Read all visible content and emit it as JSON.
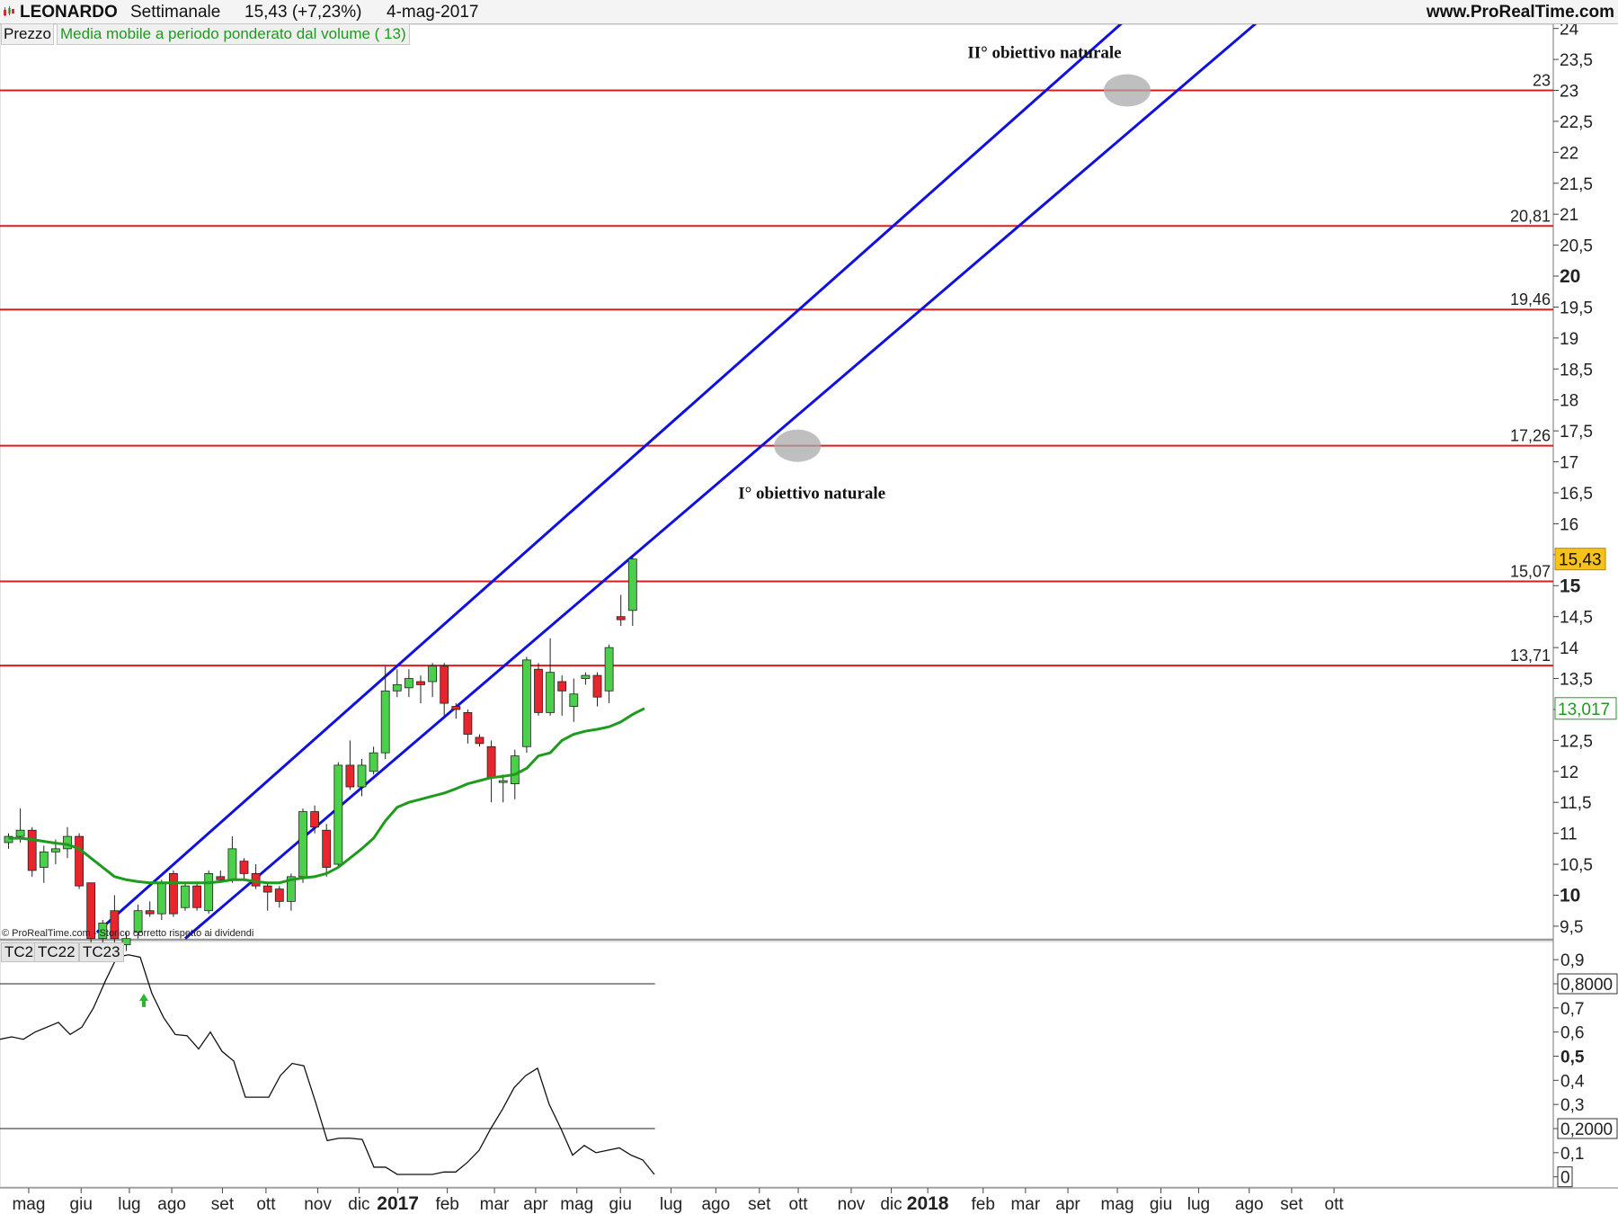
{
  "header": {
    "symbol": "LEONARDO",
    "timeframe": "Settimanale",
    "price_change": "15,43 (+7,23%)",
    "date": "4-mag-2017",
    "website": "www.ProRealTime.com"
  },
  "legend": {
    "price_label": "Prezzo",
    "indicator_label": "Media mobile a periodo ponderato dal volume ( 13)",
    "indicator_color": "#1f9a1f"
  },
  "oscillator_tabs": [
    "TC2",
    "TC22",
    "TC23"
  ],
  "copyright": "© ProRealTime.com - Storico corretto rispetto ai dividendi",
  "colors": {
    "up": "#4cd04c",
    "down": "#e8242c",
    "support_lines": "#e01b1b",
    "channel": "#1010e0",
    "moving_average": "#1f9a1f",
    "last_price_badge": "#f7c21c"
  },
  "chart_data": [
    {
      "type": "candlestick",
      "title": "LEONARDO Settimanale",
      "ylim": [
        9.3,
        24.2
      ],
      "y_ticks": [
        "24",
        "23,5",
        "23",
        "22,5",
        "22",
        "21,5",
        "21",
        "20,5",
        "20",
        "19,5",
        "19",
        "18,5",
        "18",
        "17,5",
        "17",
        "16,5",
        "16",
        "15,5",
        "15",
        "14,5",
        "14",
        "13,5",
        "13",
        "12,5",
        "12",
        "11,5",
        "11",
        "10,5",
        "10",
        "9,5"
      ],
      "y_tick_values": [
        24,
        23.5,
        23,
        22.5,
        22,
        21.5,
        21,
        20.5,
        20,
        19.5,
        19,
        18.5,
        18,
        17.5,
        17,
        16.5,
        16,
        15.5,
        15,
        14.5,
        14,
        13.5,
        13,
        12.5,
        12,
        11.5,
        11,
        10.5,
        10,
        9.5
      ],
      "x_labels": [
        "mag",
        "giu",
        "lug",
        "ago",
        "set",
        "ott",
        "nov",
        "dic",
        "2017",
        "feb",
        "mar",
        "apr",
        "mag",
        "giu",
        "lug",
        "ago",
        "set",
        "ott",
        "nov",
        "dic",
        "2018",
        "feb",
        "mar",
        "apr",
        "mag",
        "giu",
        "lug",
        "ago",
        "set",
        "ott"
      ],
      "candles": [
        {
          "o": 10.85,
          "h": 11.0,
          "l": 10.75,
          "c": 10.95
        },
        {
          "o": 10.95,
          "h": 11.4,
          "l": 10.85,
          "c": 11.05
        },
        {
          "o": 11.05,
          "h": 11.1,
          "l": 10.3,
          "c": 10.4
        },
        {
          "o": 10.45,
          "h": 10.8,
          "l": 10.2,
          "c": 10.7
        },
        {
          "o": 10.7,
          "h": 10.9,
          "l": 10.5,
          "c": 10.75
        },
        {
          "o": 10.75,
          "h": 11.1,
          "l": 10.6,
          "c": 10.95
        },
        {
          "o": 10.95,
          "h": 11.0,
          "l": 10.1,
          "c": 10.15
        },
        {
          "o": 10.2,
          "h": 10.2,
          "l": 9.2,
          "c": 9.3
        },
        {
          "o": 9.3,
          "h": 9.6,
          "l": 9.1,
          "c": 9.55
        },
        {
          "o": 9.75,
          "h": 10.0,
          "l": 9.2,
          "c": 9.3
        },
        {
          "o": 9.2,
          "h": 9.4,
          "l": 9.1,
          "c": 9.3
        },
        {
          "o": 9.4,
          "h": 9.85,
          "l": 9.3,
          "c": 9.75
        },
        {
          "o": 9.75,
          "h": 9.9,
          "l": 9.65,
          "c": 9.7
        },
        {
          "o": 9.7,
          "h": 10.25,
          "l": 9.6,
          "c": 10.2
        },
        {
          "o": 10.35,
          "h": 10.4,
          "l": 9.65,
          "c": 9.7
        },
        {
          "o": 9.8,
          "h": 10.2,
          "l": 9.75,
          "c": 10.15
        },
        {
          "o": 10.15,
          "h": 10.2,
          "l": 9.75,
          "c": 9.8
        },
        {
          "o": 9.75,
          "h": 10.4,
          "l": 9.7,
          "c": 10.35
        },
        {
          "o": 10.3,
          "h": 10.4,
          "l": 10.2,
          "c": 10.25
        },
        {
          "o": 10.25,
          "h": 10.95,
          "l": 10.2,
          "c": 10.75
        },
        {
          "o": 10.55,
          "h": 10.6,
          "l": 10.25,
          "c": 10.35
        },
        {
          "o": 10.35,
          "h": 10.5,
          "l": 10.1,
          "c": 10.15
        },
        {
          "o": 10.15,
          "h": 10.2,
          "l": 9.75,
          "c": 10.05
        },
        {
          "o": 10.1,
          "h": 10.15,
          "l": 9.8,
          "c": 9.9
        },
        {
          "o": 9.9,
          "h": 10.35,
          "l": 9.75,
          "c": 10.3
        },
        {
          "o": 10.3,
          "h": 11.4,
          "l": 10.2,
          "c": 11.35
        },
        {
          "o": 11.35,
          "h": 11.45,
          "l": 11.0,
          "c": 11.1
        },
        {
          "o": 11.05,
          "h": 11.15,
          "l": 10.3,
          "c": 10.45
        },
        {
          "o": 10.5,
          "h": 12.15,
          "l": 10.45,
          "c": 12.1
        },
        {
          "o": 12.1,
          "h": 12.5,
          "l": 11.7,
          "c": 11.75
        },
        {
          "o": 11.75,
          "h": 12.2,
          "l": 11.6,
          "c": 12.1
        },
        {
          "o": 12.0,
          "h": 12.4,
          "l": 11.95,
          "c": 12.3
        },
        {
          "o": 12.3,
          "h": 13.7,
          "l": 12.2,
          "c": 13.3
        },
        {
          "o": 13.3,
          "h": 13.65,
          "l": 13.2,
          "c": 13.4
        },
        {
          "o": 13.35,
          "h": 13.65,
          "l": 13.2,
          "c": 13.5
        },
        {
          "o": 13.45,
          "h": 13.55,
          "l": 13.1,
          "c": 13.4
        },
        {
          "o": 13.45,
          "h": 13.75,
          "l": 13.2,
          "c": 13.7
        },
        {
          "o": 13.7,
          "h": 13.75,
          "l": 12.9,
          "c": 13.1
        },
        {
          "o": 13.05,
          "h": 13.1,
          "l": 12.85,
          "c": 13.0
        },
        {
          "o": 12.95,
          "h": 13.0,
          "l": 12.45,
          "c": 12.6
        },
        {
          "o": 12.55,
          "h": 12.6,
          "l": 12.4,
          "c": 12.45
        },
        {
          "o": 12.4,
          "h": 12.5,
          "l": 11.5,
          "c": 11.9
        },
        {
          "o": 11.85,
          "h": 11.95,
          "l": 11.5,
          "c": 11.85
        },
        {
          "o": 11.8,
          "h": 12.35,
          "l": 11.55,
          "c": 12.25
        },
        {
          "o": 12.4,
          "h": 13.85,
          "l": 12.3,
          "c": 13.8
        },
        {
          "o": 13.65,
          "h": 13.75,
          "l": 12.9,
          "c": 12.95
        },
        {
          "o": 12.95,
          "h": 14.15,
          "l": 12.9,
          "c": 13.6
        },
        {
          "o": 13.45,
          "h": 13.55,
          "l": 12.9,
          "c": 13.3
        },
        {
          "o": 13.05,
          "h": 13.5,
          "l": 12.8,
          "c": 13.25
        },
        {
          "o": 13.5,
          "h": 13.6,
          "l": 13.4,
          "c": 13.55
        },
        {
          "o": 13.55,
          "h": 13.6,
          "l": 13.05,
          "c": 13.2
        },
        {
          "o": 13.3,
          "h": 14.05,
          "l": 13.1,
          "c": 14.0
        },
        {
          "o": 14.5,
          "h": 14.85,
          "l": 14.35,
          "c": 14.45
        },
        {
          "o": 14.6,
          "h": 15.5,
          "l": 14.35,
          "c": 15.43
        }
      ],
      "moving_average": [
        10.92,
        10.92,
        10.9,
        10.87,
        10.84,
        10.82,
        10.75,
        10.6,
        10.45,
        10.3,
        10.25,
        10.22,
        10.2,
        10.2,
        10.2,
        10.2,
        10.2,
        10.2,
        10.22,
        10.25,
        10.25,
        10.22,
        10.2,
        10.2,
        10.25,
        10.28,
        10.3,
        10.35,
        10.45,
        10.6,
        10.75,
        10.92,
        11.2,
        11.42,
        11.5,
        11.55,
        11.6,
        11.65,
        11.72,
        11.8,
        11.85,
        11.9,
        11.92,
        11.95,
        12.05,
        12.25,
        12.3,
        12.5,
        12.6,
        12.65,
        12.68,
        12.72,
        12.8,
        12.92,
        13.017
      ],
      "horizontal_levels": [
        {
          "value": 23,
          "label": "23"
        },
        {
          "value": 20.81,
          "label": "20,81"
        },
        {
          "value": 19.46,
          "label": "19,46"
        },
        {
          "value": 17.26,
          "label": "17,26"
        },
        {
          "value": 15.07,
          "label": "15,07"
        },
        {
          "value": 13.71,
          "label": "13,71"
        }
      ],
      "channel_lines": [
        {
          "from": {
            "week": 7.5,
            "price": 9.4
          },
          "to": {
            "week": 97,
            "price": 24.5
          }
        },
        {
          "from": {
            "week": 15,
            "price": 9.3
          },
          "to": {
            "week": 108.5,
            "price": 24.5
          }
        }
      ],
      "targets": [
        {
          "week": 67,
          "price": 17.26,
          "text": "I° obiettivo naturale"
        },
        {
          "week": 95,
          "price": 23.0,
          "text": "II° obiettivo naturale"
        }
      ],
      "last_price": "15,43",
      "ma_last_value": "13,017"
    },
    {
      "type": "line",
      "title": "TC23",
      "ylim": [
        -0.02,
        0.95
      ],
      "y_ticks": [
        "0,9",
        "0,8000",
        "0,7",
        "0,6",
        "0,5",
        "0,4",
        "0,3",
        "0,2000",
        "0,1",
        "0"
      ],
      "y_tick_values": [
        0.9,
        0.8,
        0.7,
        0.6,
        0.5,
        0.4,
        0.3,
        0.2,
        0.1,
        0
      ],
      "reference_lines": [
        0.8,
        0.2
      ],
      "values": [
        0.57,
        0.58,
        0.57,
        0.6,
        0.62,
        0.64,
        0.59,
        0.62,
        0.7,
        0.81,
        0.91,
        0.92,
        0.91,
        0.76,
        0.66,
        0.59,
        0.585,
        0.53,
        0.6,
        0.52,
        0.48,
        0.33,
        0.33,
        0.33,
        0.42,
        0.47,
        0.46,
        0.31,
        0.15,
        0.16,
        0.16,
        0.155,
        0.04,
        0.04,
        0.01,
        0.01,
        0.01,
        0.01,
        0.02,
        0.02,
        0.06,
        0.11,
        0.2,
        0.28,
        0.37,
        0.42,
        0.45,
        0.3,
        0.2,
        0.09,
        0.13,
        0.1,
        0.11,
        0.12,
        0.09,
        0.07,
        0.01
      ],
      "signal_arrow": {
        "index": 13,
        "value": 0.7
      }
    }
  ]
}
